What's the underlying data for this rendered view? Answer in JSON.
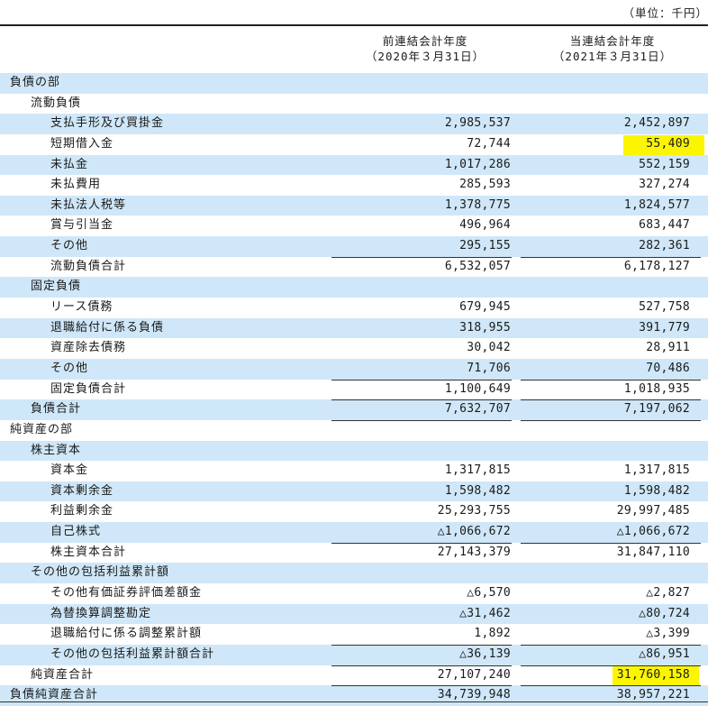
{
  "unit_label": "（単位：千円）",
  "columns": {
    "prev_line1": "前連結会計年度",
    "prev_line2": "（2020年３月31日）",
    "cur_line1": "当連結会計年度",
    "cur_line2": "（2021年３月31日）"
  },
  "highlight_color": "#fbf500",
  "shade_color": "#cfe7f8",
  "rows": [
    {
      "label": "負債の部",
      "prev": "",
      "cur": ""
    },
    {
      "label": "流動負債",
      "prev": "",
      "cur": ""
    },
    {
      "label": "支払手形及び買掛金",
      "prev": "2,985,537",
      "cur": "2,452,897"
    },
    {
      "label": "短期借入金",
      "prev": "72,744",
      "cur": "55,409"
    },
    {
      "label": "未払金",
      "prev": "1,017,286",
      "cur": "552,159"
    },
    {
      "label": "未払費用",
      "prev": "285,593",
      "cur": "327,274"
    },
    {
      "label": "未払法人税等",
      "prev": "1,378,775",
      "cur": "1,824,577"
    },
    {
      "label": "賞与引当金",
      "prev": "496,964",
      "cur": "683,447"
    },
    {
      "label": "その他",
      "prev": "295,155",
      "cur": "282,361"
    },
    {
      "label": "流動負債合計",
      "prev": "6,532,057",
      "cur": "6,178,127"
    },
    {
      "label": "固定負債",
      "prev": "",
      "cur": ""
    },
    {
      "label": "リース債務",
      "prev": "679,945",
      "cur": "527,758"
    },
    {
      "label": "退職給付に係る負債",
      "prev": "318,955",
      "cur": "391,779"
    },
    {
      "label": "資産除去債務",
      "prev": "30,042",
      "cur": "28,911"
    },
    {
      "label": "その他",
      "prev": "71,706",
      "cur": "70,486"
    },
    {
      "label": "固定負債合計",
      "prev": "1,100,649",
      "cur": "1,018,935"
    },
    {
      "label": "負債合計",
      "prev": "7,632,707",
      "cur": "7,197,062"
    },
    {
      "label": "純資産の部",
      "prev": "",
      "cur": ""
    },
    {
      "label": "株主資本",
      "prev": "",
      "cur": ""
    },
    {
      "label": "資本金",
      "prev": "1,317,815",
      "cur": "1,317,815"
    },
    {
      "label": "資本剰余金",
      "prev": "1,598,482",
      "cur": "1,598,482"
    },
    {
      "label": "利益剰余金",
      "prev": "25,293,755",
      "cur": "29,997,485"
    },
    {
      "label": "自己株式",
      "prev": "△1,066,672",
      "cur": "△1,066,672"
    },
    {
      "label": "株主資本合計",
      "prev": "27,143,379",
      "cur": "31,847,110"
    },
    {
      "label": "その他の包括利益累計額",
      "prev": "",
      "cur": ""
    },
    {
      "label": "その他有価証券評価差額金",
      "prev": "△6,570",
      "cur": "△2,827"
    },
    {
      "label": "為替換算調整勘定",
      "prev": "△31,462",
      "cur": "△80,724"
    },
    {
      "label": "退職給付に係る調整累計額",
      "prev": "1,892",
      "cur": "△3,399"
    },
    {
      "label": "その他の包括利益累計額合計",
      "prev": "△36,139",
      "cur": "△86,951"
    },
    {
      "label": "純資産合計",
      "prev": "27,107,240",
      "cur": "31,760,158"
    },
    {
      "label": "負債純資産合計",
      "prev": "34,739,948",
      "cur": "38,957,221"
    }
  ]
}
